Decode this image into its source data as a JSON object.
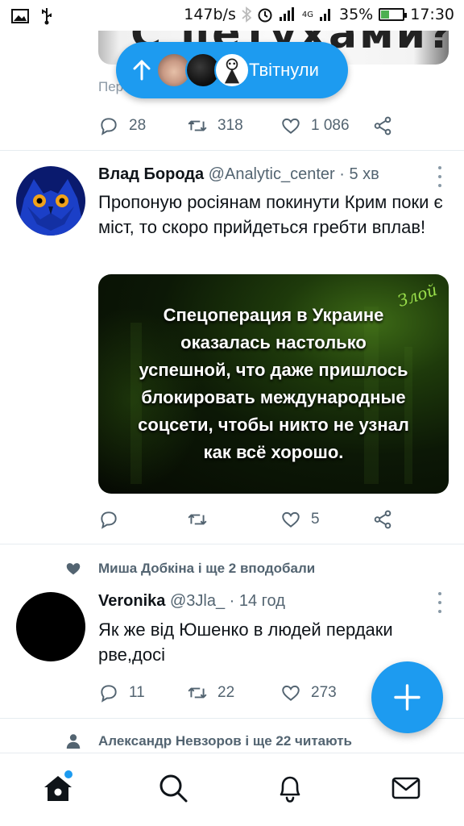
{
  "status_bar": {
    "speed": "147b/s",
    "network": "4G",
    "battery_percent": "35%",
    "battery_level": 0.35,
    "time": "17:30"
  },
  "new_tweets_pill": {
    "label": "Твітнули",
    "direction_icon": "arrow-up-icon"
  },
  "previous_tweet": {
    "image_text": "С петухами?",
    "label": "Пер",
    "replies": "28",
    "retweets": "318",
    "likes": "1 086"
  },
  "tweets": [
    {
      "name": "Влад Борода",
      "handle": "@Analytic_center",
      "time": "· 5 хв",
      "text": "Пропоную росіянам покинути Крим поки є міст, то скоро прийдеться гребти вплав!",
      "media_text": "Спецоперация в Украине\nоказалась настолько\nуспешной, что даже пришлось\nблокировать международные\nсоцсети, чтобы никто не узнал\nкак всё хорошо.",
      "media_signature": "Злой",
      "replies": "",
      "retweets": "",
      "likes": "5"
    },
    {
      "social_context": "Миша Добкіна і ще 2 вподобали",
      "name": "Veronika",
      "handle": "@3Jla_",
      "time": "· 14 год",
      "text": "Як же від Юшенко в людей пердаки рве,досі",
      "replies": "11",
      "retweets": "22",
      "likes": "273"
    },
    {
      "social_context": "Александр Невзоров і ще 22 читають"
    }
  ],
  "bottom_nav": {
    "items": [
      "home-icon",
      "search-icon",
      "notifications-icon",
      "messages-icon"
    ]
  },
  "colors": {
    "accent": "#1d9bf0",
    "text": "#0f1419",
    "muted": "#536471"
  }
}
